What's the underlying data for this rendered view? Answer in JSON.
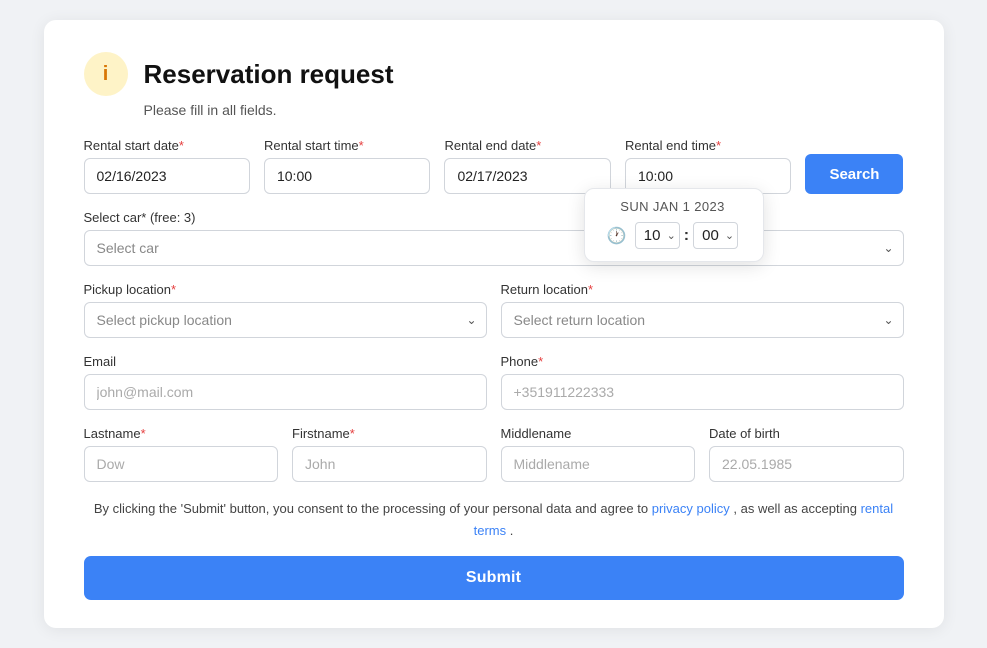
{
  "header": {
    "icon": "i",
    "title": "Reservation request",
    "subtitle": "Please fill in all fields."
  },
  "fields": {
    "rental_start_date_label": "Rental start date",
    "rental_start_date_value": "02/16/2023",
    "rental_start_time_label": "Rental start time",
    "rental_start_time_value": "10:00",
    "rental_end_date_label": "Rental end date",
    "rental_end_date_value": "02/17/2023",
    "rental_end_time_label": "Rental end time",
    "rental_end_time_value": "10:00",
    "search_button": "Search",
    "select_car_label": "Select car* (free: 3)",
    "select_car_placeholder": "Select car",
    "pickup_location_label": "Pickup location",
    "pickup_location_placeholder": "Select pickup location",
    "return_location_label": "Return location",
    "return_location_placeholder": "Select return location",
    "email_label": "Email",
    "email_placeholder": "john@mail.com",
    "phone_label": "Phone",
    "phone_placeholder": "+351911222333",
    "lastname_label": "Lastname",
    "lastname_placeholder": "Dow",
    "firstname_label": "Firstname",
    "firstname_placeholder": "John",
    "middlename_label": "Middlename",
    "middlename_placeholder": "Middlename",
    "dob_label": "Date of birth",
    "dob_placeholder": "22.05.1985"
  },
  "time_popup": {
    "header": "SUN JAN 1 2023",
    "hour": "10",
    "minute": "00"
  },
  "consent": {
    "text_before": "By clicking the 'Submit' button, you consent to the processing of your personal data and agree to",
    "privacy_policy_label": "privacy policy",
    "text_between": ", as well as accepting",
    "rental_terms_label": "rental terms",
    "text_after": "."
  },
  "submit_button": "Submit"
}
